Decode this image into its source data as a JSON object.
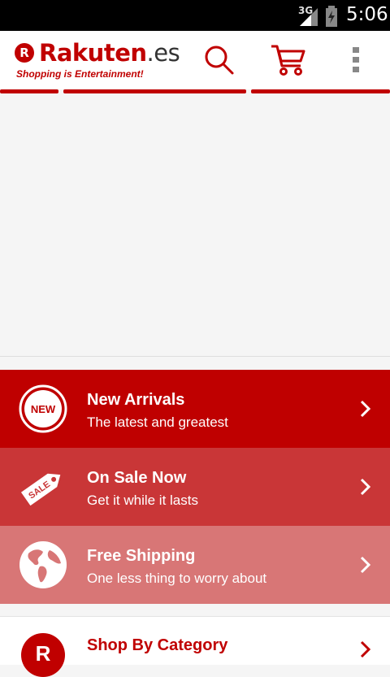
{
  "status_bar": {
    "network": "3G",
    "time": "5:06"
  },
  "app_bar": {
    "logo_name": "Rakuten",
    "logo_suffix": ".es",
    "logo_mark": "R",
    "tagline": "Shopping is Entertainment!",
    "icons": [
      "search-icon",
      "cart-icon",
      "overflow-menu-icon"
    ]
  },
  "promos": [
    {
      "title": "New Arrivals",
      "subtitle": "The latest and greatest",
      "badge": "NEW",
      "color": "#bf0000"
    },
    {
      "title": "On Sale Now",
      "subtitle": "Get it while it lasts",
      "badge": "SALE",
      "color": "#c93637"
    },
    {
      "title": "Free Shipping",
      "subtitle": "One less thing to worry about",
      "badge": "",
      "color": "#d87676"
    }
  ],
  "category": {
    "title": "Shop By Category",
    "mark": "R"
  },
  "colors": {
    "brand": "#c00000"
  }
}
